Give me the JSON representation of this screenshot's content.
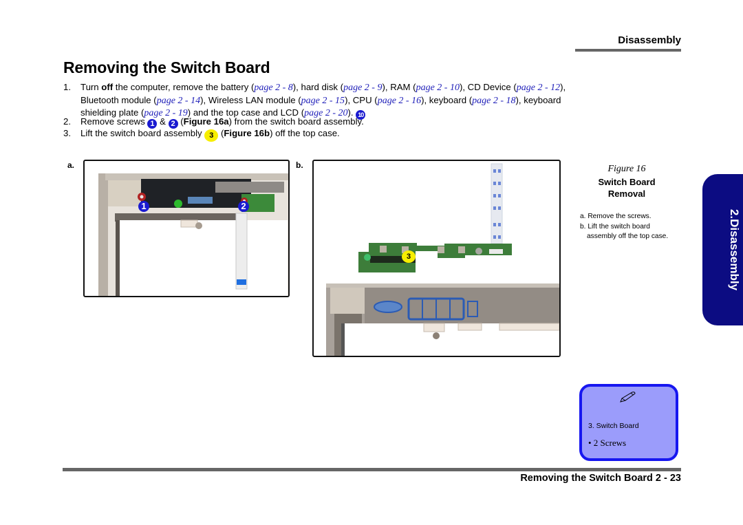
{
  "header": {
    "section": "Disassembly"
  },
  "title": "Removing the Switch Board",
  "steps": [
    {
      "num": "1.",
      "t1": "Turn ",
      "t1b": "off",
      "t2": " the computer, remove the battery (",
      "r1": "page 2 - 8",
      "t3": "), hard disk (",
      "r2": "page 2 - 9",
      "t4": "),  RAM (",
      "r3": "page 2 - 10",
      "t5": "), CD Device (",
      "r4": "page 2 - 12",
      "t6": "), Bluetooth module (",
      "r5": "page 2 - 14",
      "t7": "), Wireless LAN module (",
      "r6": "page 2 - 15",
      "t8": "), CPU (",
      "r7": "page 2 - 16",
      "t9": "), keyboard (",
      "r8": "page 2 - 18",
      "t10": "), keyboard shielding plate (",
      "r9": "page 2 - 19",
      "t11": ") and the top case and LCD (",
      "r10": "page 2 - 20",
      "t12": "). ",
      "badge": "10"
    },
    {
      "num": "2.",
      "t1": "Remove screws ",
      "badge1": "1",
      "t2": " & ",
      "badge2": "2",
      "t3": " (",
      "fig": "Figure 16a",
      "t4": ") from the switch board assembly."
    },
    {
      "num": "3.",
      "t1": "Lift the switch board assembly ",
      "badge": "3",
      "t2": " (",
      "fig": "Figure 16b",
      "t3": ") off the top case."
    }
  ],
  "figures": {
    "a": {
      "label": "a.",
      "callouts": [
        "1",
        "2"
      ]
    },
    "b": {
      "label": "b.",
      "callouts": [
        "3"
      ]
    }
  },
  "caption": {
    "figure": "Figure 16",
    "title_line1": "Switch Board",
    "title_line2": "Removal",
    "notes": [
      "a. Remove the screws.",
      "b. Lift the switch board assembly off the top case."
    ]
  },
  "side_tab": {
    "label": "2.Disassembly",
    "color": "#0c0c82"
  },
  "note_box": {
    "icon": "pencil-icon",
    "item": "3.  Switch Board",
    "bullet": "•  2 Screws"
  },
  "footer": {
    "text": "Removing the Switch Board  2  -  23"
  },
  "colors": {
    "callout_blue": "#1a1ad0",
    "callout_yellow": "#f7ee00",
    "ref_link": "#1d1db8",
    "note_fill": "#9b9cfb",
    "note_border": "#1717f0"
  }
}
